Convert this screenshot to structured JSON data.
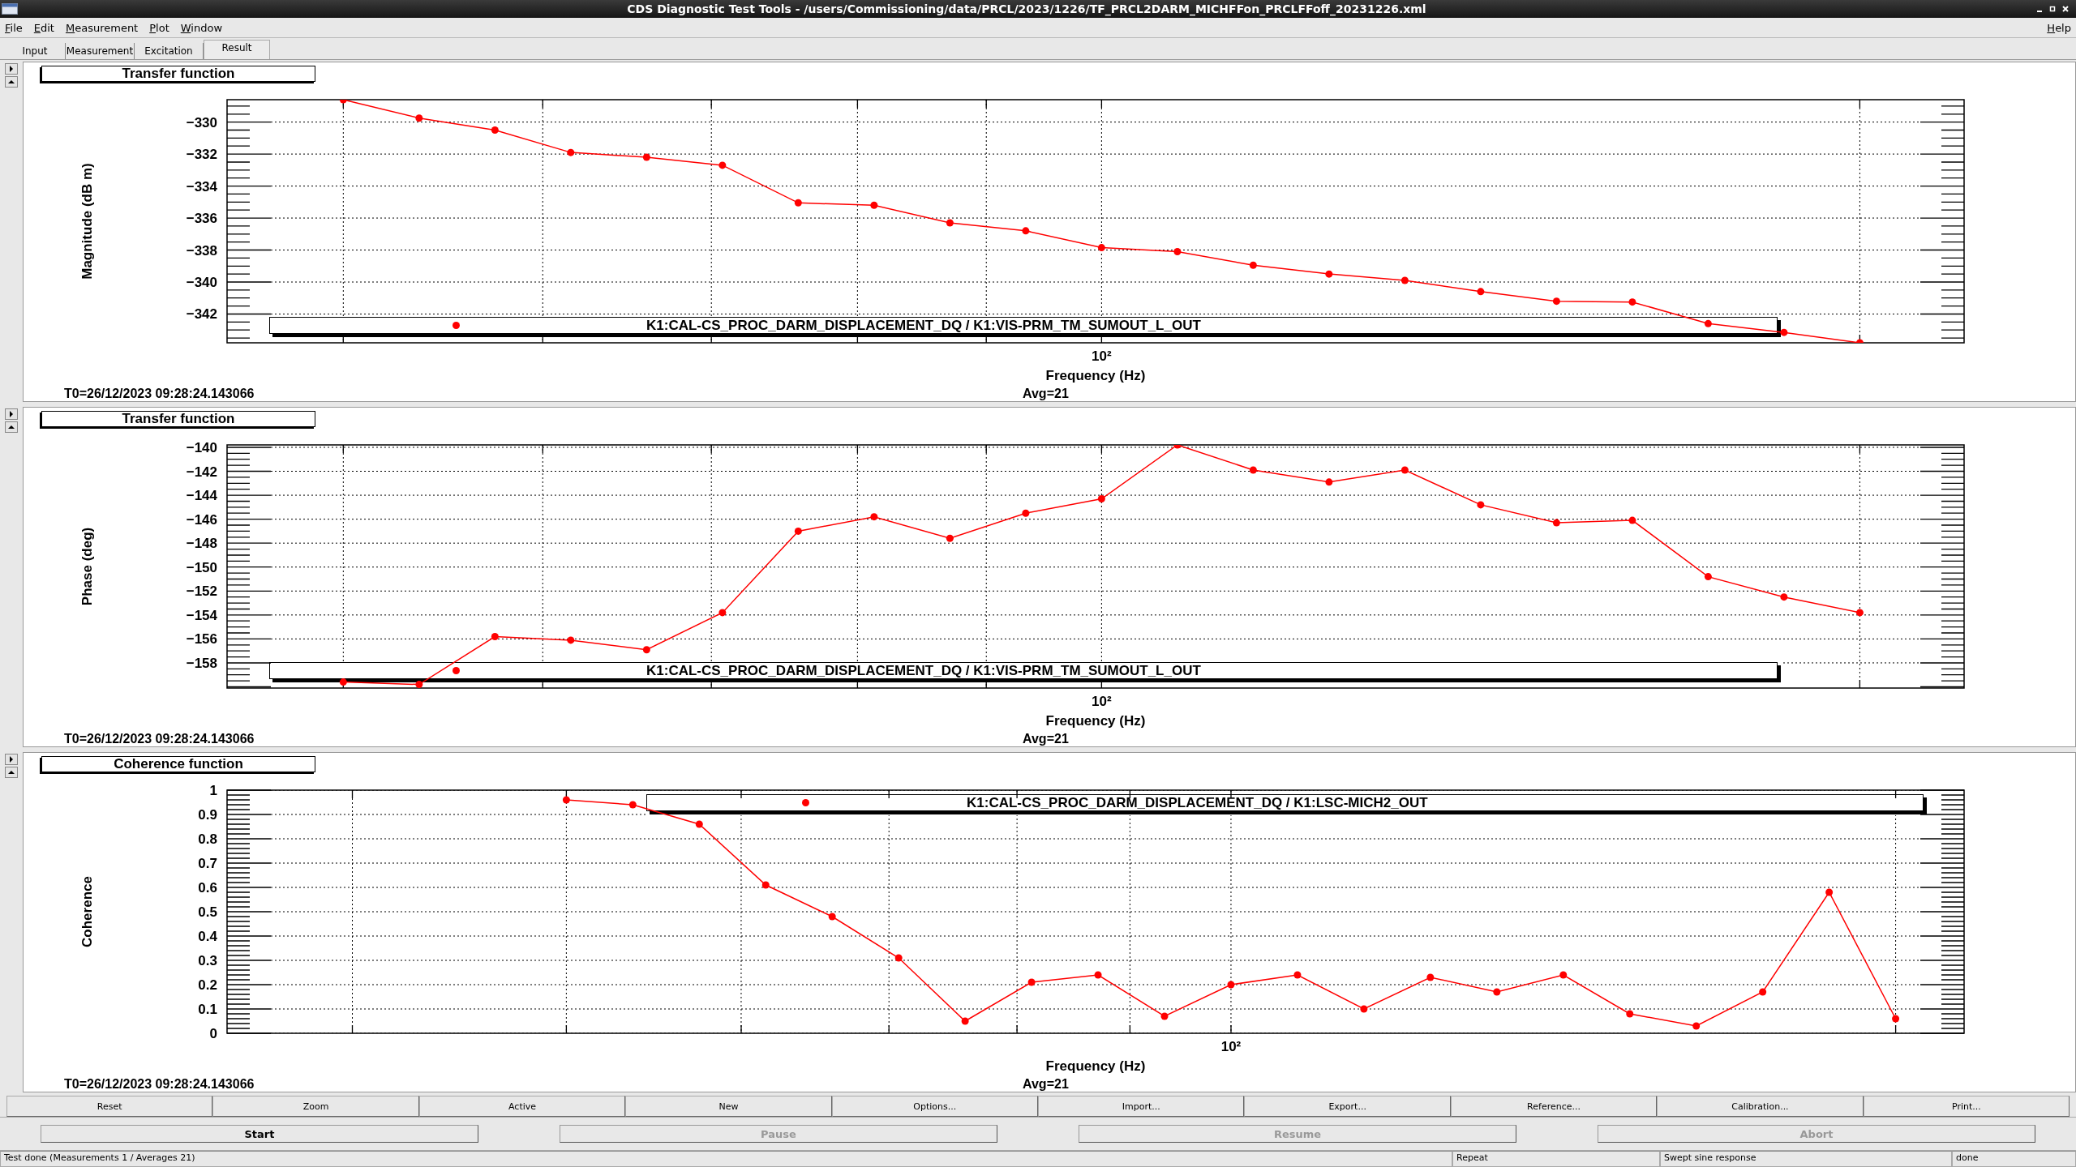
{
  "window": {
    "title": "CDS Diagnostic Test Tools - /users/Commissioning/data/PRCL/2023/1226/TF_PRCL2DARM_MICHFFon_PRCLFFoff_20231226.xml"
  },
  "menu": [
    "File",
    "Edit",
    "Measurement",
    "Plot",
    "Window"
  ],
  "menu_right": [
    "Help"
  ],
  "tabs": [
    {
      "label": "Input",
      "selected": false
    },
    {
      "label": "Measurement",
      "selected": false
    },
    {
      "label": "Excitation",
      "selected": false
    },
    {
      "label": "Result",
      "selected": true
    }
  ],
  "panes": [
    {
      "t0": "T0=26/12/2023 09:28:24.143066",
      "avg": "Avg=21",
      "chart_data": {
        "type": "line",
        "title": "Transfer function",
        "xlabel": "Frequency (Hz)",
        "ylabel": "Magnitude (dB m)",
        "grid": true,
        "series": [
          {
            "name": "K1:CAL-CS_PROC_DARM_DISPLACEMENT_DQ / K1:VIS-PRM_TM_SUMOUT_L_OUT",
            "color": "#ff0000",
            "marker": "circle",
            "values": [
              -328.6,
              -329.75,
              -330.5,
              -331.9,
              -332.2,
              -332.7,
              -335.05,
              -335.2,
              -336.3,
              -336.8,
              -337.85,
              -338.1,
              -338.95,
              -339.5,
              -339.9,
              -340.6,
              -341.2,
              -341.25,
              -342.6,
              -343.15,
              -343.8
            ]
          }
        ],
        "ylim": [
          -343.8,
          -328.6
        ],
        "yticks": [
          {
            "value": -342,
            "label": "−342"
          },
          {
            "value": -340,
            "label": "−340"
          },
          {
            "value": -338,
            "label": "−338"
          },
          {
            "value": -336,
            "label": "−336"
          },
          {
            "value": -334,
            "label": "−334"
          },
          {
            "value": -332,
            "label": "−332"
          },
          {
            "value": -330,
            "label": "−330"
          }
        ]
      },
      "x_tick_label": "10²"
    },
    {
      "t0": "T0=26/12/2023 09:28:24.143066",
      "avg": "Avg=21",
      "chart_data": {
        "type": "line",
        "title": "Transfer function",
        "xlabel": "Frequency (Hz)",
        "ylabel": "Phase (deg)",
        "grid": true,
        "series": [
          {
            "name": "K1:CAL-CS_PROC_DARM_DISPLACEMENT_DQ / K1:VIS-PRM_TM_SUMOUT_L_OUT",
            "color": "#ff0000",
            "marker": "circle",
            "values": [
              -159.6,
              -159.8,
              -155.8,
              -156.1,
              -156.9,
              -153.8,
              -147.0,
              -145.8,
              -147.6,
              -145.5,
              -144.3,
              -139.8,
              -141.9,
              -142.9,
              -141.9,
              -144.8,
              -146.3,
              -146.1,
              -150.8,
              -152.5,
              -153.8
            ]
          }
        ],
        "ylim": [
          -160.1,
          -139.8
        ],
        "yticks": [
          {
            "value": -158,
            "label": "−158"
          },
          {
            "value": -156,
            "label": "−156"
          },
          {
            "value": -154,
            "label": "−154"
          },
          {
            "value": -152,
            "label": "−152"
          },
          {
            "value": -150,
            "label": "−150"
          },
          {
            "value": -148,
            "label": "−148"
          },
          {
            "value": -146,
            "label": "−146"
          },
          {
            "value": -144,
            "label": "−144"
          },
          {
            "value": -142,
            "label": "−142"
          },
          {
            "value": -140,
            "label": "−140"
          }
        ]
      },
      "x_tick_label": "10²"
    },
    {
      "t0": "T0=26/12/2023 09:28:24.143066",
      "avg": "Avg=21",
      "chart_data": {
        "type": "line",
        "title": "Coherence function",
        "xlabel": "Frequency (Hz)",
        "ylabel": "Coherence",
        "grid": true,
        "series": [
          {
            "name": "K1:CAL-CS_PROC_DARM_DISPLACEMENT_DQ / K1:LSC-MICH2_OUT",
            "color": "#ff0000",
            "marker": "circle",
            "values": [
              0.96,
              0.94,
              0.86,
              0.61,
              0.48,
              0.31,
              0.05,
              0.21,
              0.24,
              0.07,
              0.2,
              0.24,
              0.1,
              0.23,
              0.17,
              0.24,
              0.08,
              0.03,
              0.17,
              0.58,
              0.06
            ]
          }
        ],
        "ylim": [
          0,
          1
        ],
        "yticks": [
          {
            "value": 0,
            "label": "0"
          },
          {
            "value": 0.1,
            "label": "0.1"
          },
          {
            "value": 0.2,
            "label": "0.2"
          },
          {
            "value": 0.3,
            "label": "0.3"
          },
          {
            "value": 0.4,
            "label": "0.4"
          },
          {
            "value": 0.5,
            "label": "0.5"
          },
          {
            "value": 0.6,
            "label": "0.6"
          },
          {
            "value": 0.7,
            "label": "0.7"
          },
          {
            "value": 0.8,
            "label": "0.8"
          },
          {
            "value": 0.9,
            "label": "0.9"
          },
          {
            "value": 1,
            "label": "1"
          }
        ]
      },
      "x_tick_label": "10²"
    }
  ],
  "action_buttons": [
    "Reset",
    "Zoom",
    "Active",
    "New",
    "Options...",
    "Import...",
    "Export...",
    "Reference...",
    "Calibration...",
    "Print..."
  ],
  "run_buttons": [
    {
      "label": "Start",
      "disabled": false
    },
    {
      "label": "Pause",
      "disabled": true
    },
    {
      "label": "Resume",
      "disabled": true
    },
    {
      "label": "Abort",
      "disabled": true
    }
  ],
  "status_bar": [
    "Test done (Measurements 1 / Averages 21)",
    "Repeat",
    "Swept sine response",
    "done"
  ]
}
